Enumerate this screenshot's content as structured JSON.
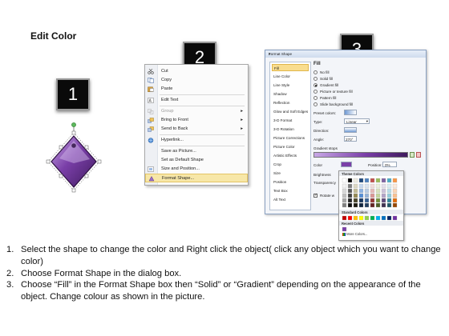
{
  "page": {
    "title": "Edit Color"
  },
  "steps": {
    "one": "1",
    "two": "2",
    "three": "3"
  },
  "context_menu": {
    "items": [
      {
        "label": "Cut",
        "icon": "scissors-icon"
      },
      {
        "label": "Copy",
        "icon": "copy-icon"
      },
      {
        "label": "Paste",
        "icon": "paste-icon"
      },
      {
        "label": "Edit Text",
        "icon": "edit-text-icon"
      },
      {
        "label": "Group",
        "icon": "group-icon"
      },
      {
        "label": "Bring to Front",
        "icon": "bring-front-icon"
      },
      {
        "label": "Send to Back",
        "icon": "send-back-icon"
      },
      {
        "label": "Hyperlink...",
        "icon": "hyperlink-icon"
      },
      {
        "label": "Save as Picture..."
      },
      {
        "label": "Set as Default Shape"
      },
      {
        "label": "Size and Position...",
        "icon": "size-icon"
      },
      {
        "label": "Format Shape...",
        "icon": "format-shape-icon"
      }
    ],
    "highlight_color": "#f7e7a8"
  },
  "dialog": {
    "title": "Format Shape",
    "close": "x",
    "categories": [
      "Fill",
      "Line Color",
      "Line Style",
      "Shadow",
      "Reflection",
      "Glow and Soft Edges",
      "3-D Format",
      "3-D Rotation",
      "Picture Corrections",
      "Picture Color",
      "Artistic Effects",
      "Crop",
      "Size",
      "Position",
      "Text Box",
      "Alt Text"
    ],
    "fill": {
      "heading": "Fill",
      "options": [
        "No fill",
        "Solid fill",
        "Gradient fill",
        "Picture or texture fill",
        "Pattern fill",
        "Slide background fill"
      ],
      "preset_label": "Preset colors:",
      "type_label": "Type:",
      "type_value": "Linear",
      "direction_label": "Direction:",
      "angle_label": "Angle:",
      "angle_value": "270°",
      "stops_label": "Gradient stops",
      "color_label": "Color",
      "position_label": "Position:",
      "position_value": "0%",
      "brightness_label": "Brightness",
      "transparency_label": "Transparency",
      "rotate_label": "Rotate w"
    },
    "gradient_color": "#7a3fa8"
  },
  "palette": {
    "theme_label": "Theme Colors",
    "standard_label": "Standard Colors",
    "recent_label": "Recent Colors",
    "more_label": "More Colors..."
  },
  "shape": {
    "fill": "#6b3591",
    "highlight": "#b48fd4",
    "handle_color": "#5cb85c"
  },
  "instructions": [
    {
      "num": "1.",
      "text": "Select the shape to change the color and Right click the object( click any object which you want to change color)"
    },
    {
      "num": "2.",
      "text": "Choose Format Shape in the dialog box."
    },
    {
      "num": "3.",
      "text": "Choose “Fill” in the Format Shape box then “Solid” or “Gradient” depending on the appearance of the object. Change colour as shown in the picture."
    }
  ]
}
